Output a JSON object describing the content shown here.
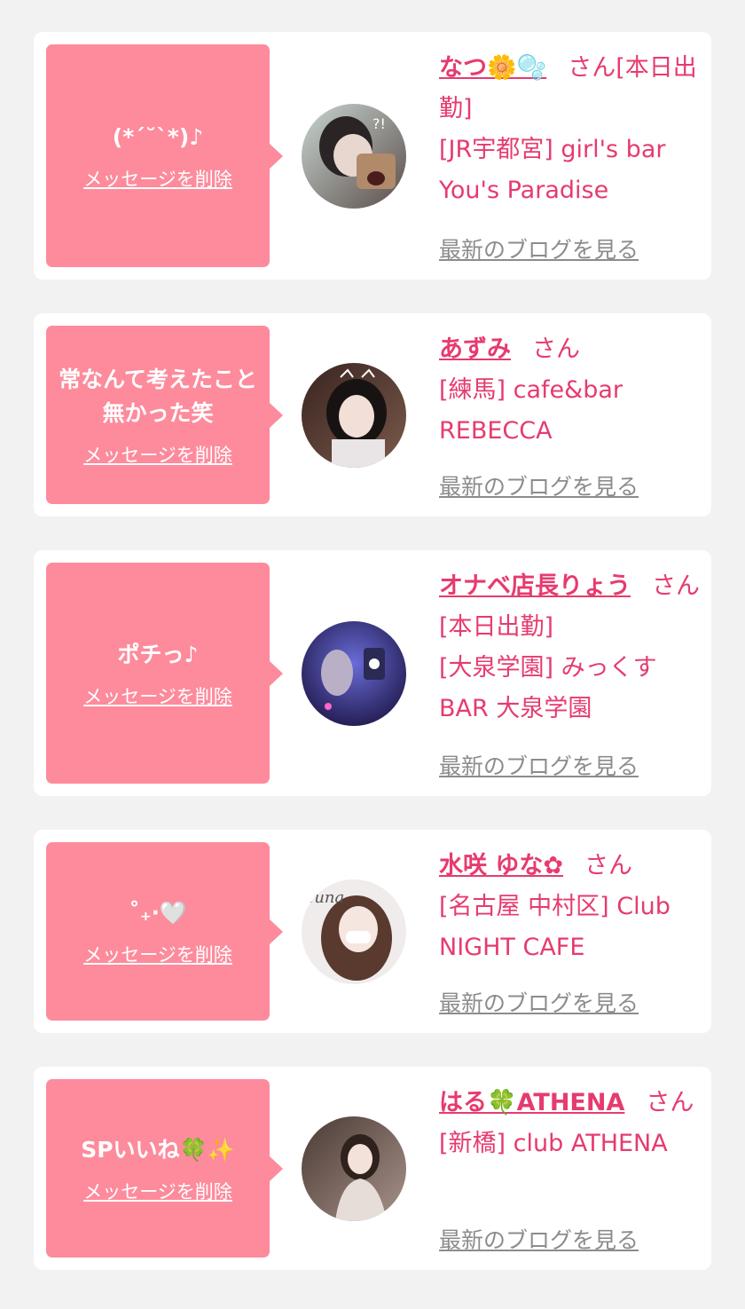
{
  "items": [
    {
      "message": "(*ˊ˘ˋ*)♪",
      "delete_label": "メッセージを削除",
      "name": "なつ🌼🫧",
      "suffix": "さん[本日出勤]",
      "shop": "[JR宇都宮] girl's bar You's Paradise",
      "blog_label": "最新のブログを見る"
    },
    {
      "message": "常なんて考えたこと無かった笑",
      "delete_label": "メッセージを削除",
      "name": "あずみ",
      "suffix": "さん",
      "shop": "[練馬] cafe&bar REBECCA",
      "blog_label": "最新のブログを見る"
    },
    {
      "message": "ポチっ♪",
      "delete_label": "メッセージを削除",
      "name": "オナベ店長りょう",
      "suffix": "さん[本日出勤]",
      "shop": "[大泉学園] みっくすBAR 大泉学園",
      "blog_label": "最新のブログを見る"
    },
    {
      "message": "˚₊‧🤍",
      "delete_label": "メッセージを削除",
      "name": "水咲 ゆな✿",
      "suffix": "さん",
      "shop": "[名古屋 中村区] Club NIGHT CAFE",
      "blog_label": "最新のブログを見る"
    },
    {
      "message": "SPいいね🍀✨",
      "delete_label": "メッセージを削除",
      "name": "はる🍀ATHENA",
      "suffix": "さん",
      "shop": "[新橋] club ATHENA",
      "blog_label": "最新のブログを見る"
    }
  ],
  "colors": {
    "bubble": "#fd8b9c",
    "accent": "#e63b6e",
    "muted": "#8c8c8c",
    "background": "#f2f2f3"
  }
}
